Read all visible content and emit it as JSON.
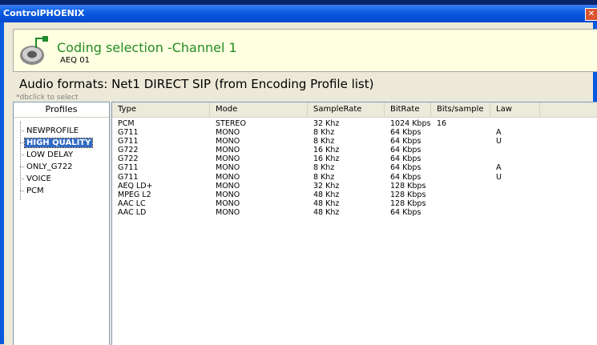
{
  "window": {
    "title": "ControlPHOENIX",
    "close_glyph": "✕"
  },
  "header": {
    "title": "Coding selection -Channel 1",
    "subtitle": "AEQ 01"
  },
  "formats": {
    "title": "Audio formats: Net1 DIRECT SIP (from Encoding Profile list)",
    "hint": "*dbclick to select"
  },
  "profiles": {
    "header": "Profiles",
    "items": [
      {
        "label": "NEWPROFILE",
        "selected": false
      },
      {
        "label": "HIGH QUALITY",
        "selected": true
      },
      {
        "label": "LOW DELAY",
        "selected": false
      },
      {
        "label": "ONLY_G722",
        "selected": false
      },
      {
        "label": "VOICE",
        "selected": false
      },
      {
        "label": "PCM",
        "selected": false
      }
    ]
  },
  "table": {
    "columns": [
      "Type",
      "Mode",
      "SampleRate",
      "BitRate",
      "Bits/sample",
      "Law"
    ],
    "rows": [
      [
        "PCM",
        "STEREO",
        "32 Khz",
        "1024 Kbps",
        "16",
        ""
      ],
      [
        "G711",
        "MONO",
        "8 Khz",
        "64 Kbps",
        "",
        "A"
      ],
      [
        "G711",
        "MONO",
        "8 Khz",
        "64 Kbps",
        "",
        "U"
      ],
      [
        "G722",
        "MONO",
        "16 Khz",
        "64 Kbps",
        "",
        ""
      ],
      [
        "G722",
        "MONO",
        "16 Khz",
        "64 Kbps",
        "",
        ""
      ],
      [
        "G711",
        "MONO",
        "8 Khz",
        "64 Kbps",
        "",
        "A"
      ],
      [
        "G711",
        "MONO",
        "8 Khz",
        "64 Kbps",
        "",
        "U"
      ],
      [
        "AEQ LD+",
        "MONO",
        "32 Khz",
        "128 Kbps",
        "",
        ""
      ],
      [
        "MPEG L2",
        "MONO",
        "48 Khz",
        "128 Kbps",
        "",
        ""
      ],
      [
        "AAC LC",
        "MONO",
        "48 Khz",
        "128 Kbps",
        "",
        ""
      ],
      [
        "AAC LD",
        "MONO",
        "48 Khz",
        "64 Kbps",
        "",
        ""
      ]
    ]
  },
  "colors": {
    "title_bar": "#0a5ae0",
    "header_bg": "#ffffe1",
    "header_text": "#238c23",
    "selection": "#316ac5"
  }
}
